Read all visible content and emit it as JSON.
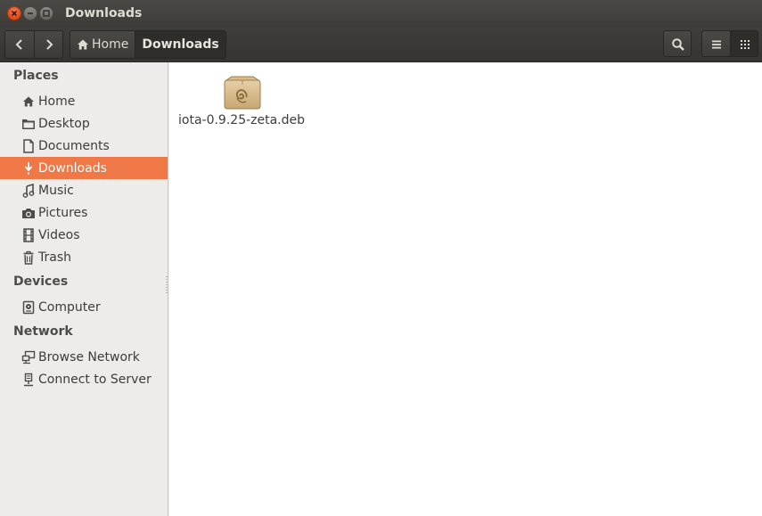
{
  "window": {
    "title": "Downloads"
  },
  "toolbar": {
    "breadcrumb": [
      {
        "label": "Home",
        "icon": "home-icon"
      },
      {
        "label": "Downloads"
      }
    ]
  },
  "sidebar": {
    "places_header": "Places",
    "places": [
      {
        "label": "Home",
        "icon": "home-icon"
      },
      {
        "label": "Desktop",
        "icon": "folder-icon"
      },
      {
        "label": "Documents",
        "icon": "document-icon"
      },
      {
        "label": "Downloads",
        "icon": "download-icon",
        "selected": true
      },
      {
        "label": "Music",
        "icon": "music-icon"
      },
      {
        "label": "Pictures",
        "icon": "camera-icon"
      },
      {
        "label": "Videos",
        "icon": "film-icon"
      },
      {
        "label": "Trash",
        "icon": "trash-icon"
      }
    ],
    "devices_header": "Devices",
    "devices": [
      {
        "label": "Computer",
        "icon": "drive-icon"
      }
    ],
    "network_header": "Network",
    "network": [
      {
        "label": "Browse Network",
        "icon": "network-icon"
      },
      {
        "label": "Connect to Server",
        "icon": "server-icon"
      }
    ]
  },
  "files": [
    {
      "name": "iota-0.9.25-zeta.deb",
      "icon": "debian-package-icon"
    }
  ],
  "colors": {
    "accent": "#f07746",
    "titlebar": "#3c3b37",
    "close": "#df4a16"
  }
}
